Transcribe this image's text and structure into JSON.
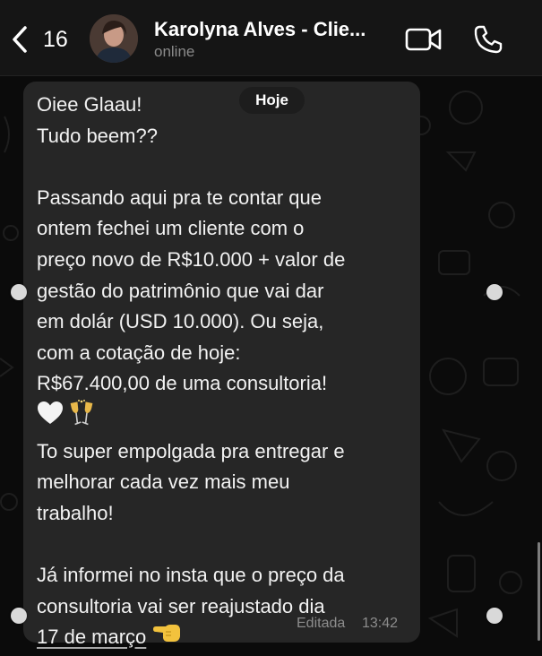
{
  "header": {
    "back_count": "16",
    "contact_name": "Karolyna Alves - Clie...",
    "status": "online"
  },
  "chat": {
    "date_pill": "Hoje",
    "message": {
      "line1": "Oiee Glaau!",
      "line2": "Tudo beem??",
      "line4": "Passando aqui pra te contar que",
      "line5": "ontem fechei um cliente com o",
      "line6": "preço novo de R$10.000 + valor de",
      "line7": "gestão do patrimônio que vai dar",
      "line8": "em dolár (USD 10.000). Ou seja,",
      "line9": "com a cotação de hoje:",
      "line10": "R$67.400,00 de uma consultoria!",
      "line12": "To super empolgada pra entregar e",
      "line13": "melhorar cada vez mais meu",
      "line14": "trabalho!",
      "line16": "Já informei no insta que o preço da",
      "line17": "consultoria vai ser reajustado dia",
      "date_link": "17 de março"
    },
    "edited_label": "Editada",
    "time": "13:42"
  },
  "icons": {
    "emoji_line": [
      "white-heart-icon",
      "clinking-glasses-icon"
    ],
    "pointing_hand": "backhand-index-pointing-left-icon"
  }
}
